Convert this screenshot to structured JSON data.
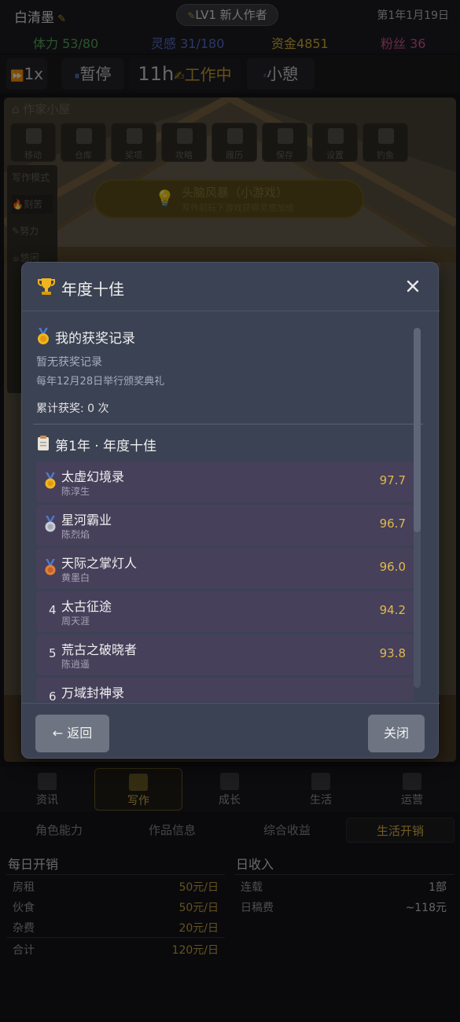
{
  "top": {
    "player_name": "白清墨",
    "level": "LV1 新人作者",
    "date": "第1年1月19日"
  },
  "stats": {
    "stamina": "体力 53/80",
    "inspiration": "灵感 31/180",
    "funds_label": "资金",
    "funds": "4851",
    "fans": "粉丝 36"
  },
  "speed": {
    "speed_label": "1x",
    "pause_label": "暂停",
    "time": "11h",
    "working": "工作中",
    "rest": "小憩"
  },
  "game": {
    "house_title": "作家小屋",
    "tools": [
      "移动",
      "仓库",
      "奖项",
      "攻略",
      "履历",
      "保存",
      "设置",
      "钓鱼"
    ],
    "side_menu_title": "写作模式",
    "side_items": [
      "刻苦",
      "努力",
      "悠闲"
    ],
    "minigame_title": "头脑风暴（小游戏）",
    "minigame_sub": "写作前玩下游戏获得灵感加成"
  },
  "modal": {
    "title": "年度十佳",
    "my_awards_title": "我的获奖记录",
    "no_awards": "暂无获奖记录",
    "ceremony_note": "每年12月28日举行颁奖典礼",
    "total_awards": "累计获奖: 0 次",
    "ranking_title": "第1年 · 年度十佳",
    "rankings": [
      {
        "rank": "1",
        "book": "太虚幻境录",
        "author": "陈淳生",
        "score": "97.7"
      },
      {
        "rank": "2",
        "book": "星河霸业",
        "author": "陈烈焰",
        "score": "96.7"
      },
      {
        "rank": "3",
        "book": "天际之掌灯人",
        "author": "黄墨白",
        "score": "96.0"
      },
      {
        "rank": "4",
        "book": "太古征途",
        "author": "周天涯",
        "score": "94.2"
      },
      {
        "rank": "5",
        "book": "荒古之破晓者",
        "author": "陈逍遥",
        "score": "93.8"
      },
      {
        "rank": "6",
        "book": "万域封神录",
        "author": "",
        "score": ""
      }
    ],
    "back_label": "← 返回",
    "close_label": "关闭"
  },
  "nav": [
    "资讯",
    "写作",
    "成长",
    "生活",
    "运营"
  ],
  "subtabs": [
    "角色能力",
    "作品信息",
    "综合收益",
    "生活开销"
  ],
  "expenses": {
    "title": "每日开销",
    "rows": [
      {
        "label": "房租",
        "value": "50元/日"
      },
      {
        "label": "伙食",
        "value": "50元/日"
      },
      {
        "label": "杂费",
        "value": "20元/日"
      },
      {
        "label": "合计",
        "value": "120元/日"
      }
    ]
  },
  "income": {
    "title": "日收入",
    "rows": [
      {
        "label": "连载",
        "value": "1部"
      },
      {
        "label": "日稿费",
        "value": "~118元"
      }
    ]
  },
  "colors": {
    "accent_gold": "#e2b84a",
    "modal_bg": "#3b4253",
    "stamina": "#58a85a",
    "inspiration": "#5b6fd0",
    "funds": "#d8b23a",
    "fans": "#d0568a"
  }
}
